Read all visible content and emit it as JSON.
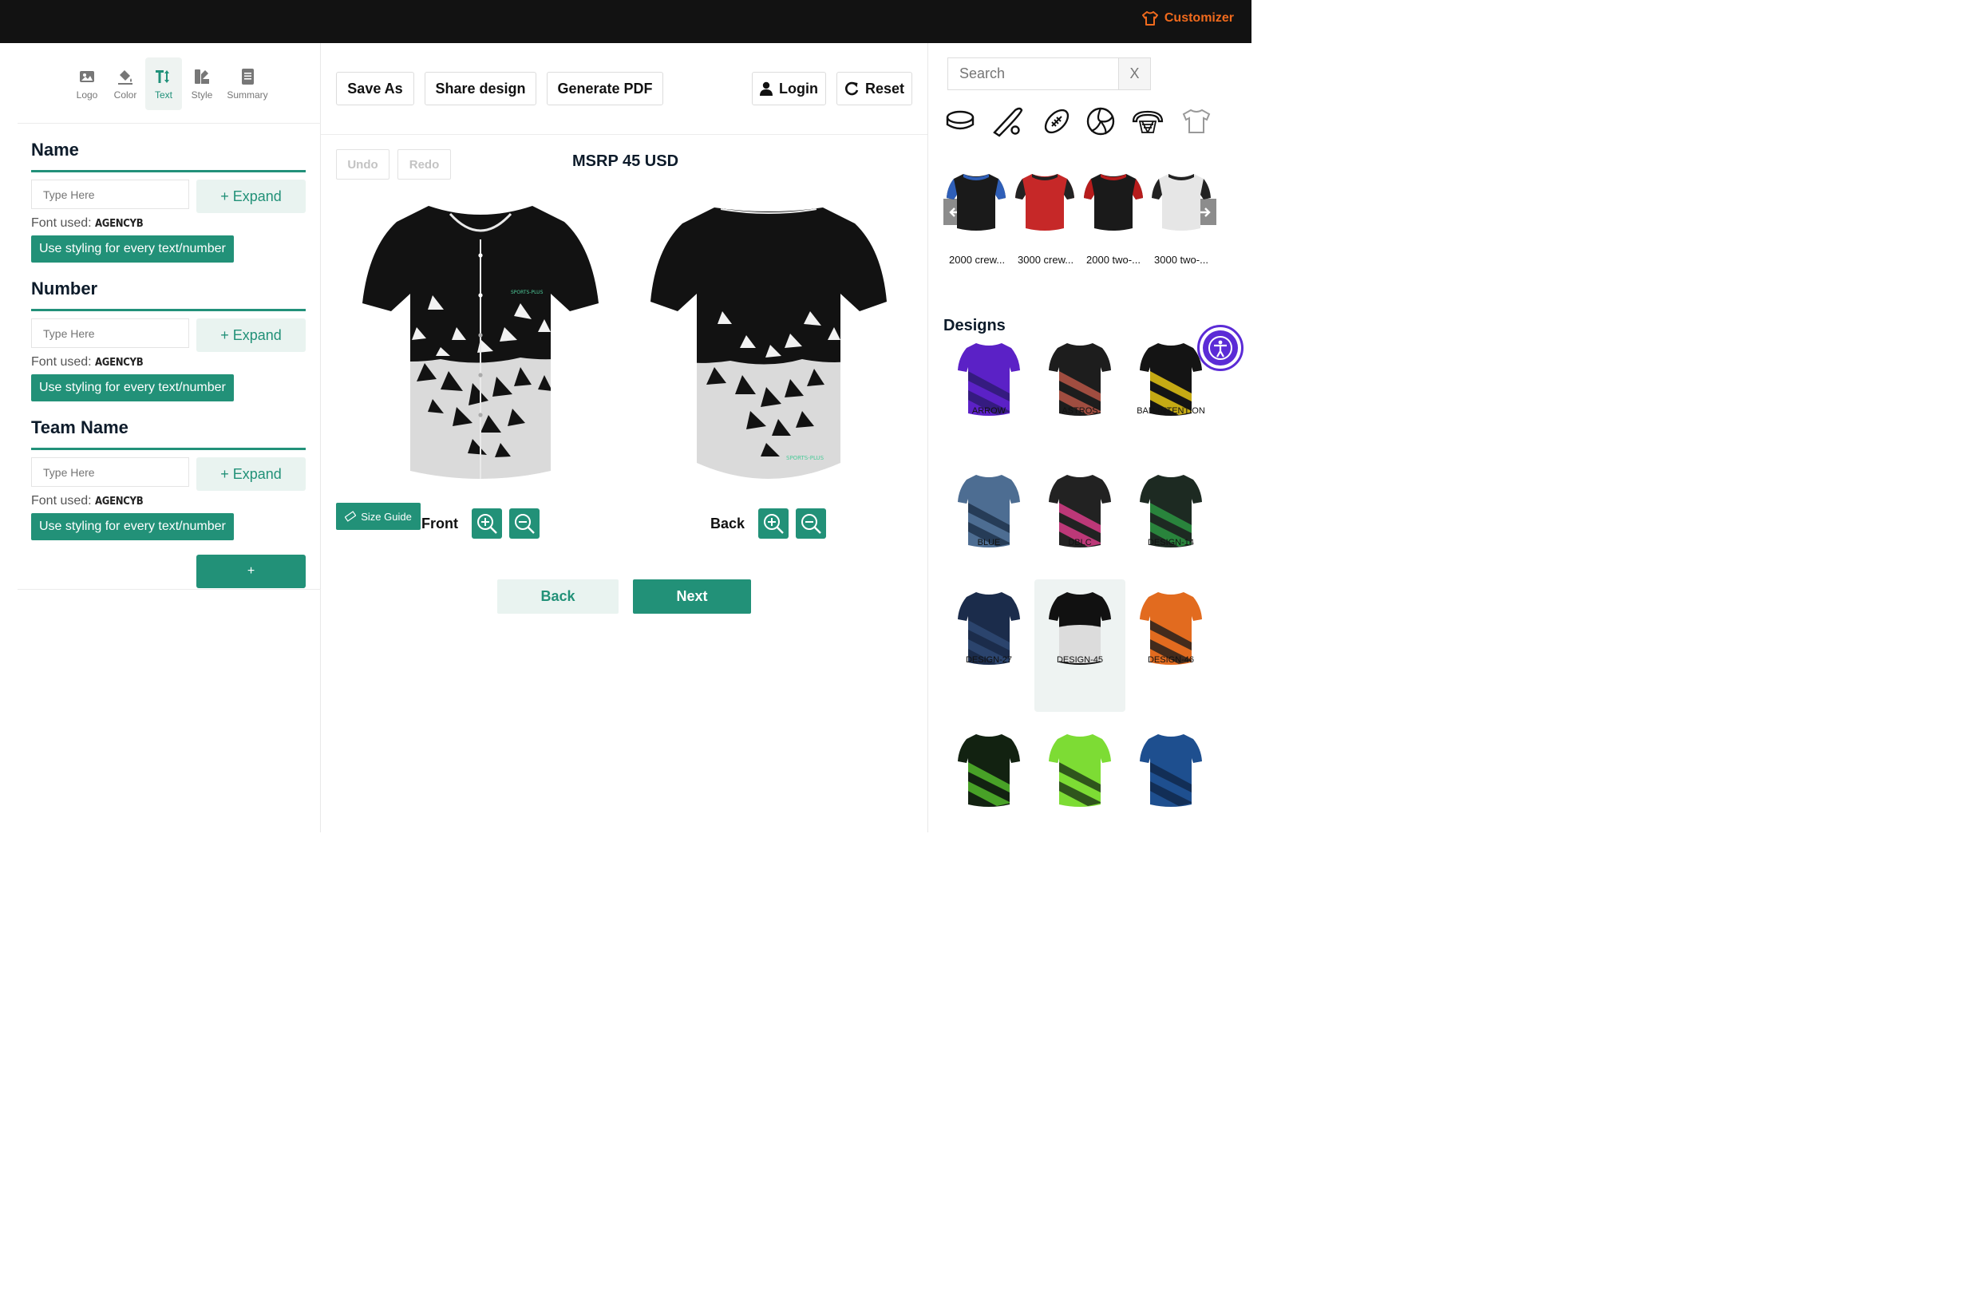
{
  "brand": {
    "label": "Customizer",
    "color": "#f06a1d"
  },
  "tabs": [
    {
      "label": "Logo",
      "icon": "image-icon"
    },
    {
      "label": "Color",
      "icon": "paint-bucket-icon"
    },
    {
      "label": "Text",
      "icon": "text-size-icon"
    },
    {
      "label": "Style",
      "icon": "palette-icon"
    },
    {
      "label": "Summary",
      "icon": "document-icon"
    }
  ],
  "active_tab": "Text",
  "text_sections": [
    {
      "title": "Name",
      "placeholder": "Type Here",
      "expand_label": "+ Expand",
      "font_prefix": "Font used: ",
      "font_name": "AGENCYB",
      "style_button": "Use styling for every text/number"
    },
    {
      "title": "Number",
      "placeholder": "Type Here",
      "expand_label": "+ Expand",
      "font_prefix": "Font used: ",
      "font_name": "AGENCYB",
      "style_button": "Use styling for every text/number"
    },
    {
      "title": "Team Name",
      "placeholder": "Type Here",
      "expand_label": "+ Expand",
      "font_prefix": "Font used: ",
      "font_name": "AGENCYB",
      "style_button": "Use styling for every text/number"
    }
  ],
  "add_button": "+",
  "toolbar": {
    "save_as": "Save As",
    "share": "Share design",
    "pdf": "Generate PDF",
    "login": "Login",
    "reset": "Reset"
  },
  "history": {
    "undo": "Undo",
    "redo": "Redo"
  },
  "price": "MSRP 45 USD",
  "views": {
    "front": "Front",
    "back": "Back"
  },
  "size_guide": "Size Guide",
  "nav": {
    "back": "Back",
    "next": "Next"
  },
  "search": {
    "placeholder": "Search",
    "clear": "X"
  },
  "sports": [
    "hockey-puck-icon",
    "baseball-icon",
    "football-icon",
    "volleyball-icon",
    "basketball-icon",
    "shirt-icon"
  ],
  "products": [
    {
      "label": "2000 crew...",
      "colors": [
        "#1a1a1a",
        "#2f5fb8"
      ]
    },
    {
      "label": "3000 crew...",
      "colors": [
        "#c62828",
        "#222222"
      ]
    },
    {
      "label": "2000 two-...",
      "colors": [
        "#1a1a1a",
        "#b71c1c"
      ]
    },
    {
      "label": "3000 two-...",
      "colors": [
        "#e6e6e6",
        "#222222"
      ]
    }
  ],
  "designs_title": "Designs",
  "designs": [
    {
      "label": "ARROW",
      "colors": [
        "#5b21c6",
        "#2c1a6e"
      ]
    },
    {
      "label": "ASTROS",
      "colors": [
        "#1d1d1d",
        "#c25a4a"
      ]
    },
    {
      "label": "BAD-INTENTION",
      "colors": [
        "#141414",
        "#f1d014"
      ]
    },
    {
      "label": "BLUE",
      "colors": [
        "#4d6d92",
        "#1d2f48"
      ]
    },
    {
      "label": "DBLC",
      "colors": [
        "#222222",
        "#e43e8f"
      ]
    },
    {
      "label": "DESIGN-14",
      "colors": [
        "#1d2a22",
        "#2d9b44"
      ]
    },
    {
      "label": "DESIGN-27",
      "colors": [
        "#1b2c4b",
        "#2f4b76"
      ]
    },
    {
      "label": "DESIGN-45",
      "colors": [
        "#111111",
        "#dcdcdc"
      ]
    },
    {
      "label": "DESIGN-46",
      "colors": [
        "#e26b1f",
        "#1b1b1b"
      ]
    },
    {
      "label": "",
      "colors": [
        "#122211",
        "#56c22d"
      ]
    },
    {
      "label": "",
      "colors": [
        "#7ddc34",
        "#1b3316"
      ]
    },
    {
      "label": "",
      "colors": [
        "#1e4f8f",
        "#0f2547"
      ]
    }
  ],
  "selected_design": "DESIGN-45",
  "accent": "#229178"
}
